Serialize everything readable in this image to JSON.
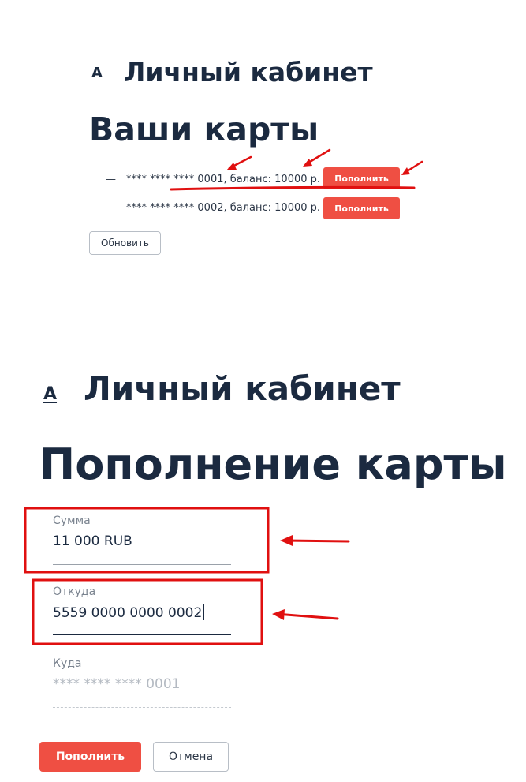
{
  "top": {
    "logo": "А",
    "cabinet_title": "Личный кабинет",
    "page_title": "Ваши карты",
    "cards": [
      {
        "dash": "—",
        "text": "**** **** **** 0001, баланс: 10000 р.",
        "button": "Пополнить"
      },
      {
        "dash": "—",
        "text": "**** **** **** 0002, баланс: 10000 р.",
        "button": "Пополнить"
      }
    ],
    "refresh_button": "Обновить"
  },
  "bottom": {
    "logo": "А",
    "cabinet_title": "Личный кабинет",
    "page_title": "Пополнение карты",
    "fields": {
      "amount": {
        "label": "Сумма",
        "value": "11 000 RUB"
      },
      "from": {
        "label": "Откуда",
        "value": "5559 0000 0000 0002"
      },
      "to": {
        "label": "Куда",
        "placeholder": "**** **** **** 0001"
      }
    },
    "submit_button": "Пополнить",
    "cancel_button": "Отмена"
  },
  "colors": {
    "primary_text": "#1b2a40",
    "accent_red": "#ef4f43",
    "annotation_red": "#e01010"
  }
}
